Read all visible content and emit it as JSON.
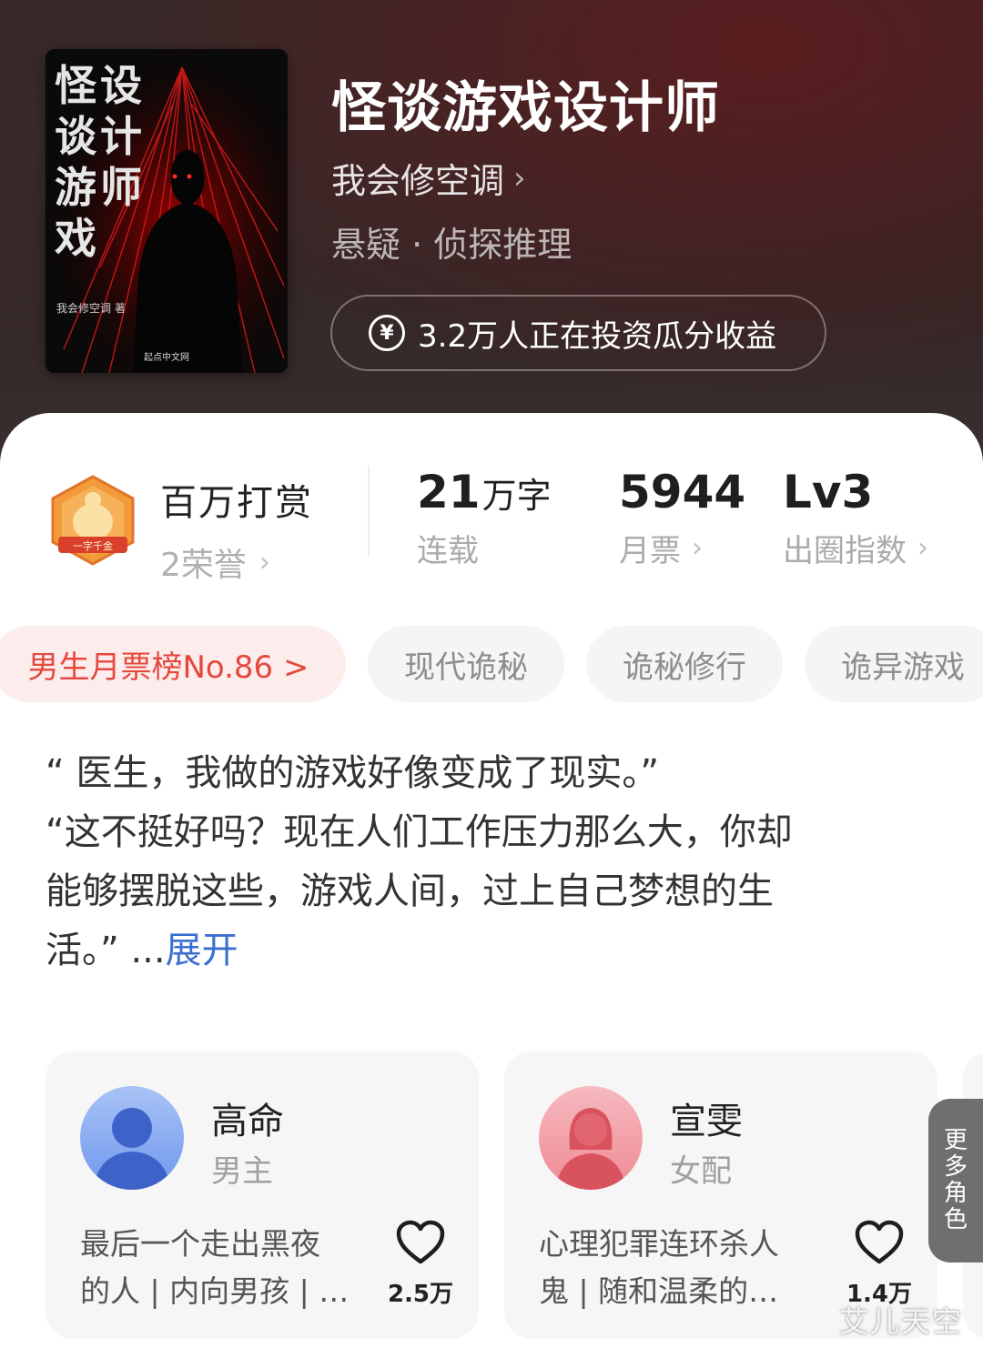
{
  "book": {
    "title": "怪谈游戏设计师",
    "author": "我会修空调",
    "genre": "悬疑 · 侦探推理",
    "invest_text": "3.2万人正在投资瓜分收益",
    "cover": {
      "title_col1": [
        "怪",
        "谈",
        "游",
        "戏"
      ],
      "title_col2": [
        "设",
        "计",
        "师"
      ],
      "author": "我会修空调 著",
      "publisher": "起点中文网"
    }
  },
  "stats": {
    "reward_title": "百万打赏",
    "reward_sub": "2荣誉",
    "badge_text": "一字千金",
    "words_num": "21",
    "words_unit": "万字",
    "words_label": "连载",
    "tickets_num": "5944",
    "tickets_label": "月票",
    "level_num": "Lv3",
    "level_label": "出圈指数"
  },
  "tags": [
    "男生月票榜No.86 >",
    "现代诡秘",
    "诡秘修行",
    "诡异游戏"
  ],
  "synopsis": {
    "line1": "“ 医生，我做的游戏好像变成了现实。”",
    "line2": "“这不挺好吗？现在人们工作压力那么大，你却",
    "line3": "能够摆脱这些，游戏人间，过上自己梦想的生",
    "line4": "活。”",
    "ellipsis": " ...",
    "expand": "展开"
  },
  "characters": [
    {
      "name": "高命",
      "role": "男主",
      "desc1": "最后一个走出黑夜",
      "desc2": "的人 | 内向男孩 | …",
      "likes": "2.5万"
    },
    {
      "name": "宣雯",
      "role": "女配",
      "desc1": "心理犯罪连环杀人",
      "desc2": "鬼 | 随和温柔的…",
      "likes": "1.4万"
    }
  ],
  "more_roles": [
    "更",
    "多",
    "角",
    "色"
  ],
  "watermark": "艾儿天空",
  "colors": {
    "rank_tag": "#e5483e",
    "expand_link": "#3b6fcf",
    "header_bg": "#2e2424"
  }
}
